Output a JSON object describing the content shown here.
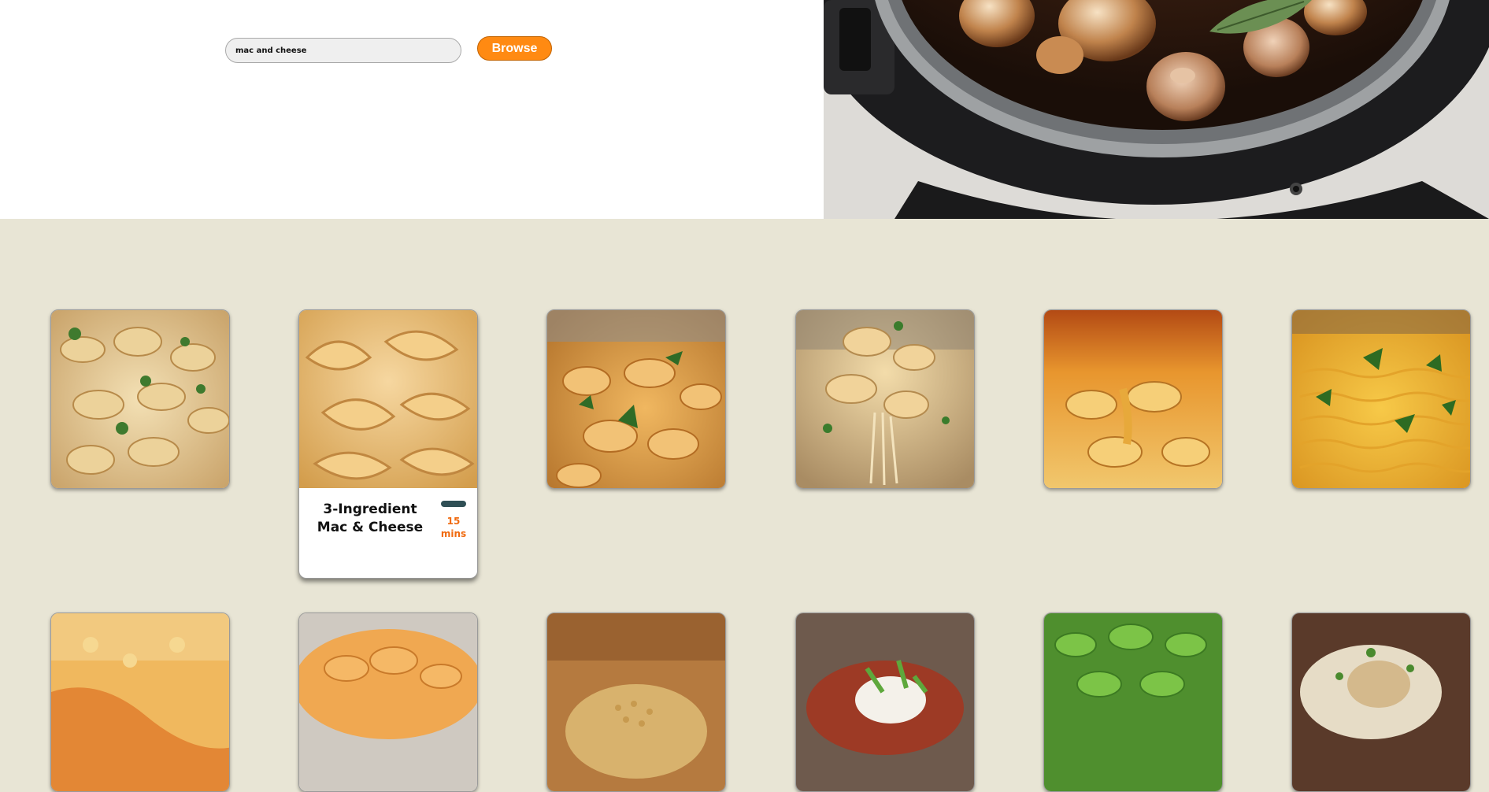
{
  "search": {
    "value": "mac and cheese",
    "button_label": "Browse"
  },
  "hero": {
    "image": "multicooker-stew-photo"
  },
  "colors": {
    "accent": "#ff8a12",
    "grid_background": "#e8e5d5",
    "time_text": "#f06a0f",
    "badge": "#2f4f55"
  },
  "recipes": [
    {
      "image": "mac-and-cheese-parsley-photo"
    },
    {
      "image": "mac-and-cheese-closeup-photo",
      "title_line1": "3-Ingredient",
      "title_line2": "Mac & Cheese",
      "time_value": "15",
      "time_unit": "mins"
    },
    {
      "image": "mac-and-cheese-herbs-photo"
    },
    {
      "image": "cheesy-pasta-stretch-photo"
    },
    {
      "image": "baked-mac-and-cheese-photo"
    },
    {
      "image": "cheddar-pasta-parsley-photo"
    },
    {
      "image": "mac-and-cheese-bake-photo"
    },
    {
      "image": "mac-and-cheese-bowl-photo"
    },
    {
      "image": "breadcrumb-mac-photo"
    },
    {
      "image": "loaded-baked-potato-mac-photo"
    },
    {
      "image": "green-pesto-mac-photo"
    },
    {
      "image": "creamy-pasta-bacon-photo"
    }
  ]
}
